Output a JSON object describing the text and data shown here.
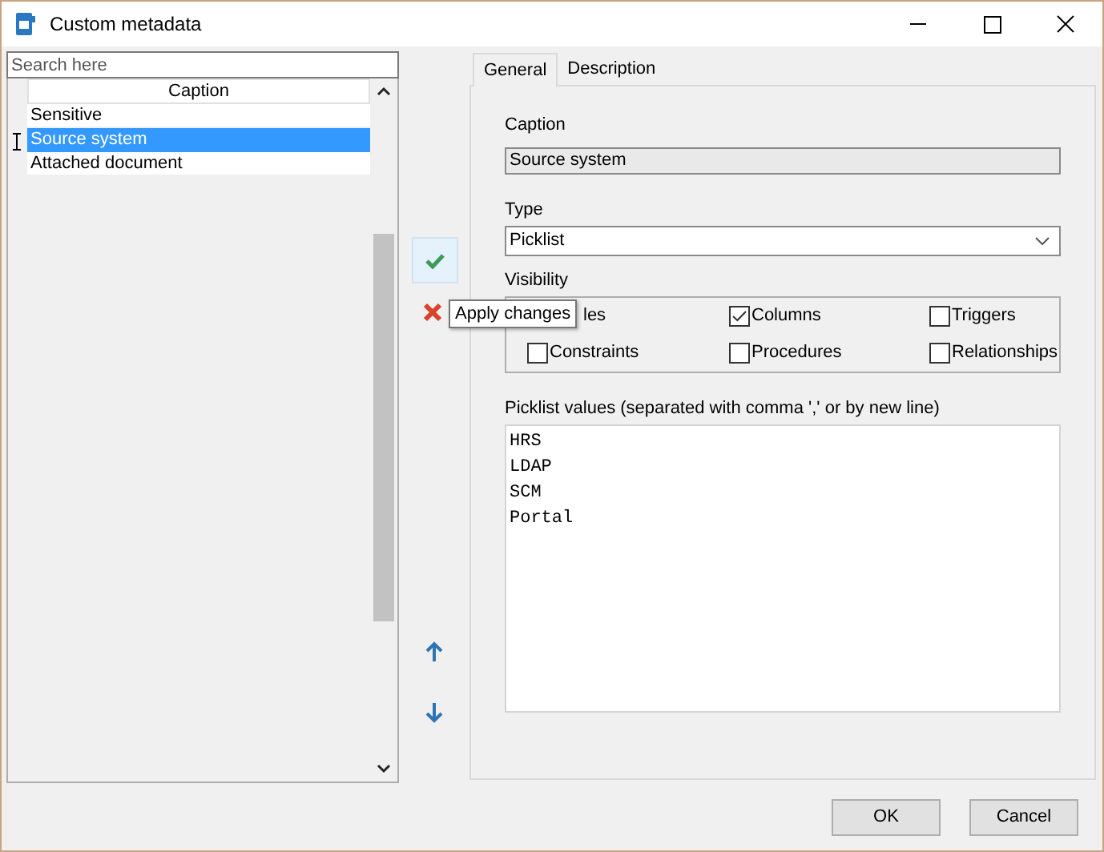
{
  "window": {
    "title": "Custom metadata"
  },
  "search": {
    "placeholder": "Search here"
  },
  "list": {
    "column": "Caption",
    "rows": [
      {
        "label": "Sensitive",
        "selected": false
      },
      {
        "label": "Source system",
        "selected": true
      },
      {
        "label": "Attached document",
        "selected": false
      }
    ]
  },
  "tooltip": "Apply changes",
  "tabs": [
    {
      "label": "General",
      "selected": true
    },
    {
      "label": "Description",
      "selected": false
    }
  ],
  "caption": {
    "label": "Caption",
    "value": "Source system"
  },
  "type": {
    "label": "Type",
    "value": "Picklist"
  },
  "visibility": {
    "label": "Visibility",
    "options": [
      {
        "kind": "covered",
        "label": "les"
      },
      {
        "kind": "checkbox",
        "label": "Columns",
        "checked": true
      },
      {
        "kind": "checkbox",
        "label": "Triggers",
        "checked": false
      },
      {
        "kind": "checkbox",
        "label": "Constraints",
        "checked": false
      },
      {
        "kind": "checkbox",
        "label": "Procedures",
        "checked": false
      },
      {
        "kind": "checkbox",
        "label": "Relationships",
        "checked": false
      }
    ]
  },
  "picklist": {
    "label": "Picklist values  (separated with comma ',' or by new line)",
    "values": [
      "HRS",
      "LDAP",
      "SCM",
      "Portal"
    ]
  },
  "buttons": [
    "OK",
    "Cancel"
  ]
}
